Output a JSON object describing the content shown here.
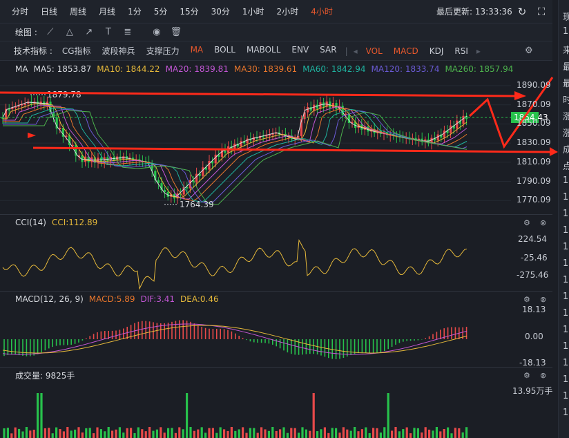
{
  "timeframes": [
    "分时",
    "日线",
    "周线",
    "月线",
    "1分",
    "5分",
    "15分",
    "30分",
    "1小时",
    "2小时",
    "4小时"
  ],
  "active_timeframe": "4小时",
  "last_update": "最后更新: 13:33:36",
  "icons": {
    "refresh": "refresh-icon",
    "fullscreen": "fullscreen-icon"
  },
  "draw_label": "绘图 :",
  "draw_tools": [
    "line-tool-icon",
    "triangle-tool-icon",
    "arrow-tool-icon",
    "text-tool-icon",
    "fib-tool-icon",
    "eye-icon",
    "trash-icon"
  ],
  "indicators_label": "技术指标 :",
  "indicators": [
    {
      "label": "CG指标",
      "on": false
    },
    {
      "label": "波段神兵",
      "on": false
    },
    {
      "label": "支撑压力",
      "on": false
    },
    {
      "label": "MA",
      "on": true
    },
    {
      "label": "BOLL",
      "on": false
    },
    {
      "label": "MABOLL",
      "on": false
    },
    {
      "label": "ENV",
      "on": false
    },
    {
      "label": "SAR",
      "on": false
    }
  ],
  "sub_indicators": [
    {
      "label": "VOL",
      "on": true
    },
    {
      "label": "MACD",
      "on": true
    },
    {
      "label": "KDJ",
      "on": false
    },
    {
      "label": "RSI",
      "on": false
    }
  ],
  "ma_legend": {
    "name": "MA",
    "items": [
      {
        "text": "MA5: 1853.87",
        "color": "#d6d9de"
      },
      {
        "text": "MA10: 1844.22",
        "color": "#e6b93a"
      },
      {
        "text": "MA20: 1839.81",
        "color": "#c457d6"
      },
      {
        "text": "MA30: 1839.61",
        "color": "#e8762c"
      },
      {
        "text": "MA60: 1842.94",
        "color": "#1fb3a0"
      },
      {
        "text": "MA120: 1833.74",
        "color": "#6b5bd6"
      },
      {
        "text": "MA260: 1857.94",
        "color": "#4db34d"
      }
    ]
  },
  "price_axis": [
    "1890.09",
    "1870.09",
    "1850.09",
    "1830.09",
    "1810.09",
    "1790.09",
    "1770.09"
  ],
  "current_price": "1854.43",
  "high_label": "1879.78",
  "low_label": "1764.39",
  "cci": {
    "title": "CCI(14)",
    "value": "CCI:112.89",
    "axis": [
      "224.54",
      "-25.46",
      "-275.46"
    ]
  },
  "macd": {
    "title": "MACD(12, 26, 9)",
    "macd": "MACD:5.89",
    "dif": "DIF:3.41",
    "dea": "DEA:0.46",
    "axis": [
      "18.13",
      "0.00",
      "-18.13"
    ]
  },
  "volume": {
    "title": "成交量: 9825手",
    "axis": "13.95万手"
  },
  "right_col": [
    "现",
    "1",
    "来",
    "最",
    "最",
    "时",
    "涨",
    "涨",
    "成",
    "点",
    "1",
    "1",
    "1",
    "1",
    "1",
    "1",
    "1",
    "1",
    "1",
    "1",
    "1",
    "1",
    "1",
    "1",
    "1"
  ],
  "colors": {
    "up": "#e84a4a",
    "down": "#27c24c",
    "accent": "#e8582c",
    "annot": "#ff2a1a"
  }
}
